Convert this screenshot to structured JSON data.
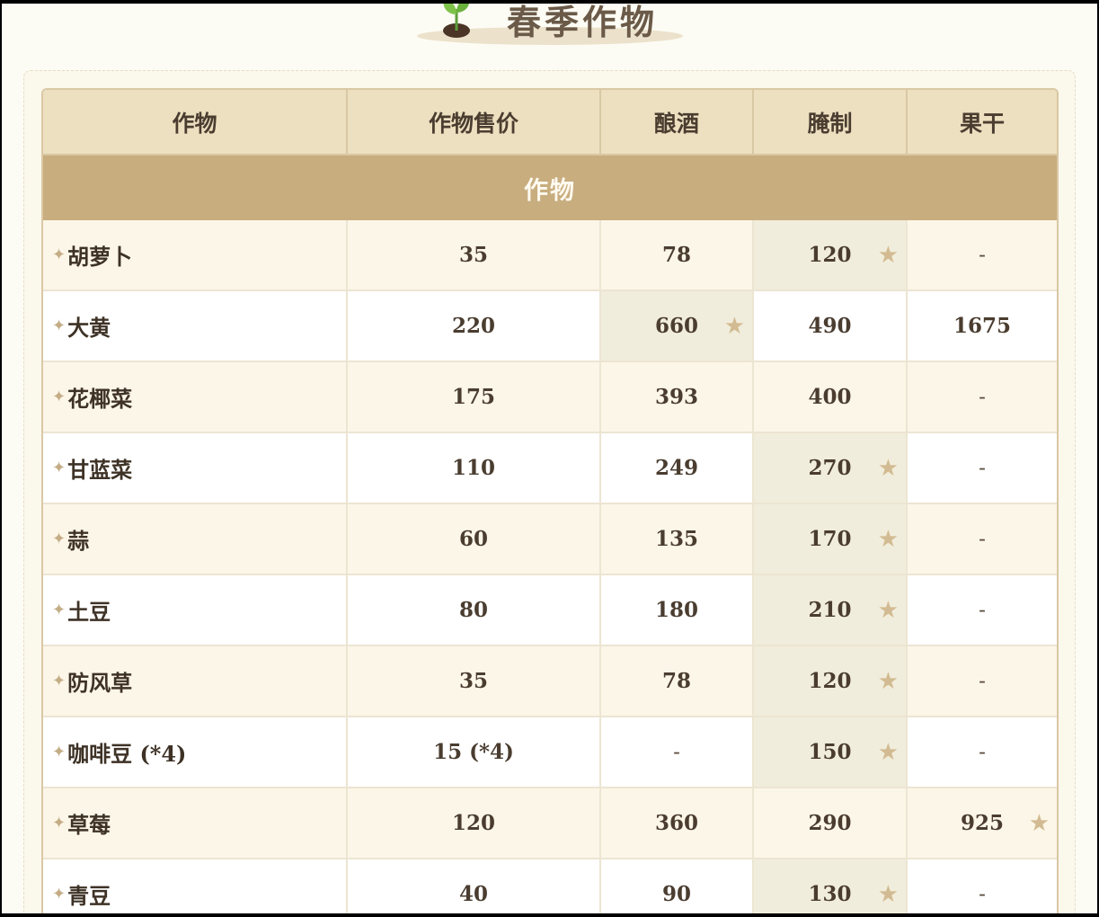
{
  "banner": {
    "title": "春季作物",
    "icon": "sprout-icon"
  },
  "table": {
    "headers": [
      "作物",
      "作物售价",
      "酿酒",
      "腌制",
      "果干"
    ],
    "section_title": "作物",
    "best_marker": "★",
    "rows": [
      {
        "name": "胡萝卜",
        "price": "35",
        "wine": "78",
        "pickle": "120",
        "dried": "-",
        "best": "pickle"
      },
      {
        "name": "大黄",
        "price": "220",
        "wine": "660",
        "pickle": "490",
        "dried": "1675",
        "best": "wine"
      },
      {
        "name": "花椰菜",
        "price": "175",
        "wine": "393",
        "pickle": "400",
        "dried": "-",
        "best": ""
      },
      {
        "name": "甘蓝菜",
        "price": "110",
        "wine": "249",
        "pickle": "270",
        "dried": "-",
        "best": "pickle"
      },
      {
        "name": "蒜",
        "price": "60",
        "wine": "135",
        "pickle": "170",
        "dried": "-",
        "best": "pickle"
      },
      {
        "name": "土豆",
        "price": "80",
        "wine": "180",
        "pickle": "210",
        "dried": "-",
        "best": "pickle"
      },
      {
        "name": "防风草",
        "price": "35",
        "wine": "78",
        "pickle": "120",
        "dried": "-",
        "best": "pickle"
      },
      {
        "name": "咖啡豆 (*4)",
        "price": "15 (*4)",
        "wine": "-",
        "pickle": "150",
        "dried": "-",
        "best": "pickle"
      },
      {
        "name": "草莓",
        "price": "120",
        "wine": "360",
        "pickle": "290",
        "dried": "925",
        "best": "dried"
      },
      {
        "name": "青豆",
        "price": "40",
        "wine": "90",
        "pickle": "130",
        "dried": "-",
        "best": "pickle"
      }
    ]
  },
  "colors": {
    "header_bg": "#ede0c0",
    "section_bg": "#c8ad7f",
    "star": "#d2bb92",
    "highlight_bg": "#f1eddc"
  }
}
